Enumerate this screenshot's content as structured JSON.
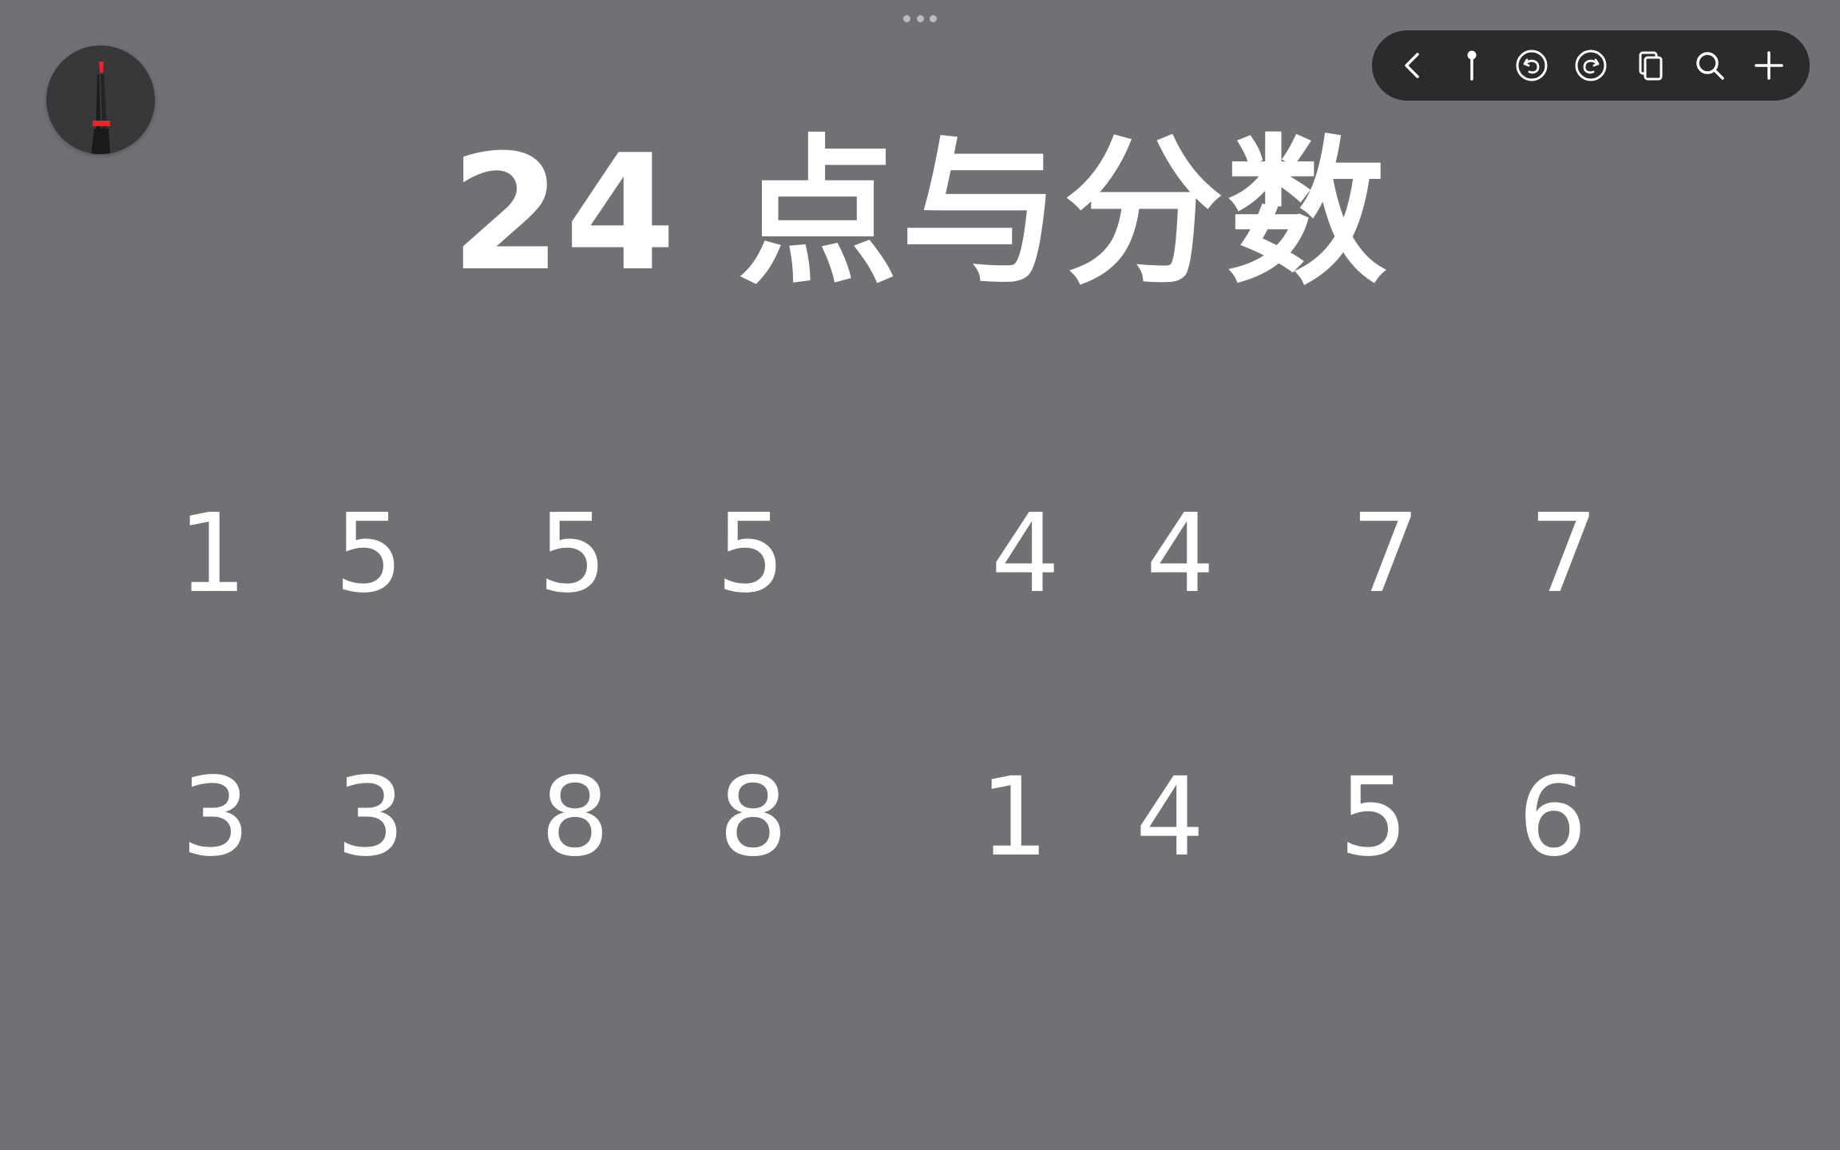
{
  "title": "24 点与分数",
  "toolbar": {
    "icons": [
      "back-icon",
      "pin-icon",
      "undo-icon",
      "redo-icon",
      "pages-icon",
      "search-icon",
      "add-icon"
    ]
  },
  "pen_tool": {
    "icon": "pen-icon",
    "accent_color": "#e8242c"
  },
  "puzzles": [
    {
      "numbers": [
        "1",
        "5",
        "5",
        "5"
      ]
    },
    {
      "numbers": [
        "4",
        "4",
        "7",
        "7"
      ]
    },
    {
      "numbers": [
        "3",
        "3",
        "8",
        "8"
      ]
    },
    {
      "numbers": [
        "1",
        "4",
        "5",
        "6"
      ]
    }
  ],
  "colors": {
    "background": "#727074",
    "toolbar": "#2b2a2d",
    "text": "#ffffff"
  }
}
